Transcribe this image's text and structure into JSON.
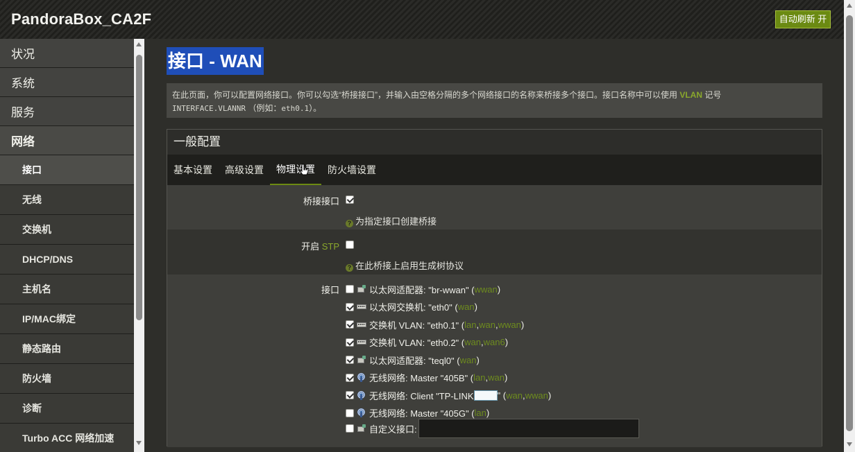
{
  "header": {
    "brand": "PandoraBox_CA2F",
    "refresh_label": "自动刷新 开"
  },
  "sidebar": {
    "items": [
      {
        "label": "状况",
        "type": "top"
      },
      {
        "label": "系统",
        "type": "top"
      },
      {
        "label": "服务",
        "type": "top"
      },
      {
        "label": "网络",
        "type": "top",
        "active": true
      },
      {
        "label": "接口",
        "type": "sub",
        "active": true
      },
      {
        "label": "无线",
        "type": "sub"
      },
      {
        "label": "交换机",
        "type": "sub"
      },
      {
        "label": "DHCP/DNS",
        "type": "sub"
      },
      {
        "label": "主机名",
        "type": "sub"
      },
      {
        "label": "IP/MAC绑定",
        "type": "sub"
      },
      {
        "label": "静态路由",
        "type": "sub"
      },
      {
        "label": "防火墙",
        "type": "sub"
      },
      {
        "label": "诊断",
        "type": "sub"
      },
      {
        "label": "Turbo ACC 网络加速",
        "type": "sub"
      }
    ]
  },
  "page": {
    "title": "接口 - WAN",
    "desc_part1": "在此页面，你可以配置网络接口。你可以勾选“桥接接口”，并输入由空格分隔的多个网络接口的名称来桥接多个接口。接口名称中可以使用",
    "desc_vlan": "VLAN",
    "desc_part2": "记号",
    "desc_mono": "INTERFACE.VLANNR",
    "desc_part3": "（例如：",
    "desc_example": "eth0.1",
    "desc_part4": "）。"
  },
  "panel": {
    "title": "一般配置",
    "tabs": [
      {
        "label": "基本设置"
      },
      {
        "label": "高级设置"
      },
      {
        "label": "物理设置",
        "active": true
      },
      {
        "label": "防火墙设置"
      }
    ],
    "bridge": {
      "label": "桥接接口",
      "checked": true,
      "hint": "为指定接口创建桥接"
    },
    "stp": {
      "label_prefix": "开启",
      "label_stp": "STP",
      "checked": false,
      "hint": "在此桥接上启用生成树协议"
    },
    "interfaces_label": "接口",
    "interfaces": [
      {
        "checked": false,
        "icon": "eth",
        "text": "以太网适配器: \"br-wwan\" (",
        "zones": [
          "wwan"
        ],
        "tail": ")"
      },
      {
        "checked": true,
        "icon": "sw",
        "text": "以太网交换机: \"eth0\" (",
        "zones": [
          "wan"
        ],
        "tail": ")"
      },
      {
        "checked": true,
        "icon": "sw",
        "text": "交换机 VLAN: \"eth0.1\" (",
        "zones": [
          "lan",
          "wan",
          "wwan"
        ],
        "tail": ")"
      },
      {
        "checked": true,
        "icon": "sw",
        "text": "交换机 VLAN: \"eth0.2\" (",
        "zones": [
          "wan",
          "wan6"
        ],
        "tail": ")"
      },
      {
        "checked": true,
        "icon": "eth",
        "text": "以太网适配器: \"teql0\" (",
        "zones": [
          "wan"
        ],
        "tail": ")"
      },
      {
        "checked": true,
        "icon": "wifi",
        "text": "无线网络: Master \"405B\" (",
        "zones": [
          "lan",
          "wan"
        ],
        "tail": ")"
      },
      {
        "checked": true,
        "icon": "wifi",
        "text": "无线网络: Client \"TP-LINK",
        "ssid_box": true,
        "text2": "\" (",
        "zones": [
          "wan",
          "wwan"
        ],
        "tail": ")"
      },
      {
        "checked": false,
        "icon": "wifi",
        "text": "无线网络: Master \"405G\" (",
        "zones": [
          "lan"
        ],
        "tail": ")"
      },
      {
        "checked": false,
        "icon": "eth",
        "text": "自定义接口:",
        "custom_input": true
      }
    ]
  },
  "colors": {
    "accent": "#6b8a12",
    "title_bg": "#1f4eb8",
    "zone": "#6e8c1e"
  }
}
